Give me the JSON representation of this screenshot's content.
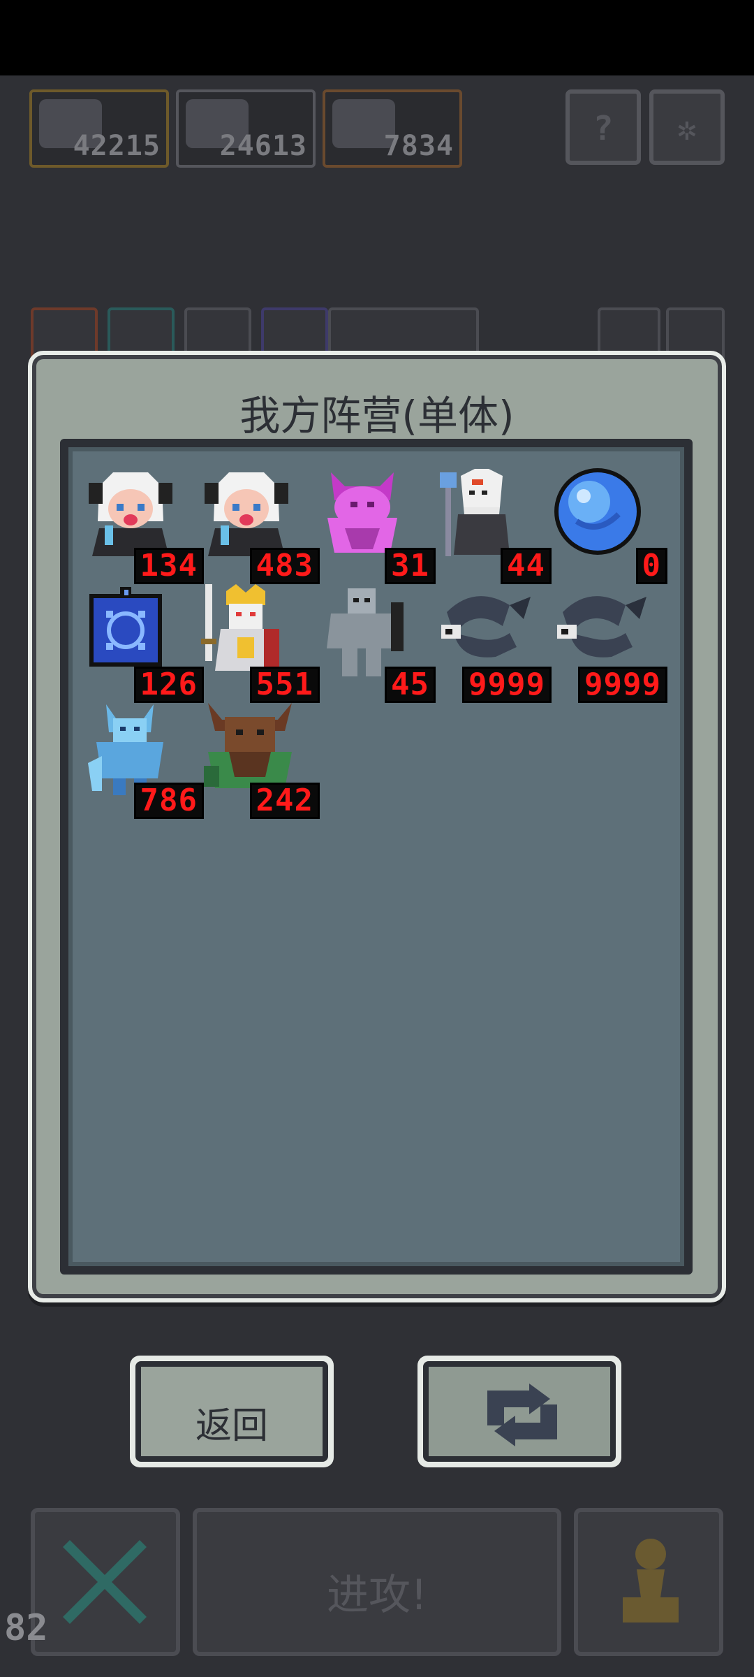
{
  "hud": {
    "resources": [
      {
        "icon": "girl-portrait-icon",
        "value": "42215"
      },
      {
        "icon": "girl-portrait-icon",
        "value": "24613"
      },
      {
        "icon": "hand-card-icon",
        "value": "7834"
      }
    ],
    "help_icon": "?",
    "settings_icon": "gear-icon"
  },
  "modal": {
    "title": "我方阵营(单体)",
    "units": [
      {
        "name": "white-haired-girl",
        "count": "134"
      },
      {
        "name": "white-haired-girl",
        "count": "483"
      },
      {
        "name": "purple-demon",
        "count": "31"
      },
      {
        "name": "white-mask-mage",
        "count": "44"
      },
      {
        "name": "blue-orb",
        "count": "0"
      },
      {
        "name": "blue-banner",
        "count": "126"
      },
      {
        "name": "armored-king",
        "count": "551"
      },
      {
        "name": "grey-golem",
        "count": "45"
      },
      {
        "name": "dark-serpent",
        "count": "9999"
      },
      {
        "name": "dark-serpent",
        "count": "9999"
      },
      {
        "name": "ice-demon",
        "count": "786"
      },
      {
        "name": "horned-treant",
        "count": "242"
      }
    ]
  },
  "buttons": {
    "back_label": "返回",
    "swap_icon": "refresh-icon"
  },
  "bottom": {
    "attack_label": "进攻!",
    "fps": "82"
  },
  "colors": {
    "count_text": "#ff1a1a",
    "panel_bg": "#5e7079",
    "modal_bg": "#9aa49c"
  }
}
